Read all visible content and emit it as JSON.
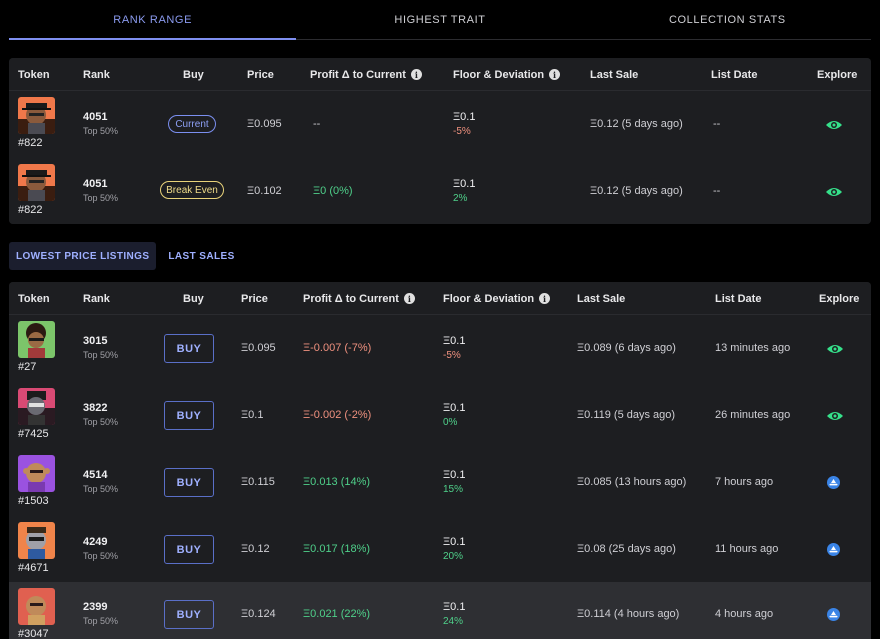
{
  "tabs": [
    {
      "label": "RANK RANGE"
    },
    {
      "label": "HIGHEST TRAIT"
    },
    {
      "label": "COLLECTION STATS"
    }
  ],
  "rank_table": {
    "headers": {
      "token": "Token",
      "rank": "Rank",
      "buy": "Buy",
      "price": "Price",
      "profit": "Profit Δ to Current",
      "floor": "Floor & Deviation",
      "last_sale": "Last Sale",
      "list_date": "List Date",
      "explore": "Explore"
    },
    "info_glyph": "i",
    "rows": [
      {
        "token_id": "#822",
        "rank": "4051",
        "rank_sub": "Top 50%",
        "buy_label": "Current",
        "price": "Ξ0.095",
        "profit": "--",
        "floor": "Ξ0.1",
        "deviation": "-5%",
        "last_sale": "Ξ0.12 (5 days ago)",
        "list_date": "--",
        "explore_icon": "eye-icon"
      },
      {
        "token_id": "#822",
        "rank": "4051",
        "rank_sub": "Top 50%",
        "buy_label": "Break Even",
        "price": "Ξ0.102",
        "profit": "Ξ0 (0%)",
        "floor": "Ξ0.1",
        "deviation": "2%",
        "last_sale": "Ξ0.12 (5 days ago)",
        "list_date": "--",
        "explore_icon": "eye-icon"
      }
    ]
  },
  "subtabs": [
    {
      "label": "LOWEST PRICE LISTINGS"
    },
    {
      "label": "LAST SALES"
    }
  ],
  "listings_table": {
    "headers": {
      "token": "Token",
      "rank": "Rank",
      "buy": "Buy",
      "price": "Price",
      "profit": "Profit Δ to Current",
      "floor": "Floor & Deviation",
      "last_sale": "Last Sale",
      "list_date": "List Date",
      "explore": "Explore"
    },
    "buy_label": "BUY",
    "rows": [
      {
        "token_id": "#27",
        "rank": "3015",
        "rank_sub": "Top 50%",
        "price": "Ξ0.095",
        "profit": "Ξ-0.007 (-7%)",
        "floor": "Ξ0.1",
        "deviation": "-5%",
        "last_sale": "Ξ0.089 (6 days ago)",
        "list_date": "13 minutes ago",
        "explore_icon": "eye-icon"
      },
      {
        "token_id": "#7425",
        "rank": "3822",
        "rank_sub": "Top 50%",
        "price": "Ξ0.1",
        "profit": "Ξ-0.002 (-2%)",
        "floor": "Ξ0.1",
        "deviation": "0%",
        "last_sale": "Ξ0.119 (5 days ago)",
        "list_date": "26 minutes ago",
        "explore_icon": "eye-icon"
      },
      {
        "token_id": "#1503",
        "rank": "4514",
        "rank_sub": "Top 50%",
        "price": "Ξ0.115",
        "profit": "Ξ0.013 (14%)",
        "floor": "Ξ0.1",
        "deviation": "15%",
        "last_sale": "Ξ0.085 (13 hours ago)",
        "list_date": "7 hours ago",
        "explore_icon": "marketplace-icon"
      },
      {
        "token_id": "#4671",
        "rank": "4249",
        "rank_sub": "Top 50%",
        "price": "Ξ0.12",
        "profit": "Ξ0.017 (18%)",
        "floor": "Ξ0.1",
        "deviation": "20%",
        "last_sale": "Ξ0.08 (25 days ago)",
        "list_date": "11 hours ago",
        "explore_icon": "marketplace-icon"
      },
      {
        "token_id": "#3047",
        "rank": "2399",
        "rank_sub": "Top 50%",
        "price": "Ξ0.124",
        "profit": "Ξ0.021 (22%)",
        "floor": "Ξ0.1",
        "deviation": "24%",
        "last_sale": "Ξ0.114 (4 hours ago)",
        "list_date": "4 hours ago",
        "explore_icon": "marketplace-icon"
      }
    ]
  },
  "colors": {
    "accent": "#8b9bf0",
    "positive": "#4fd08a",
    "negative": "#f0917f",
    "eye": "#35e08a",
    "marketplace": "#3a84e6"
  }
}
